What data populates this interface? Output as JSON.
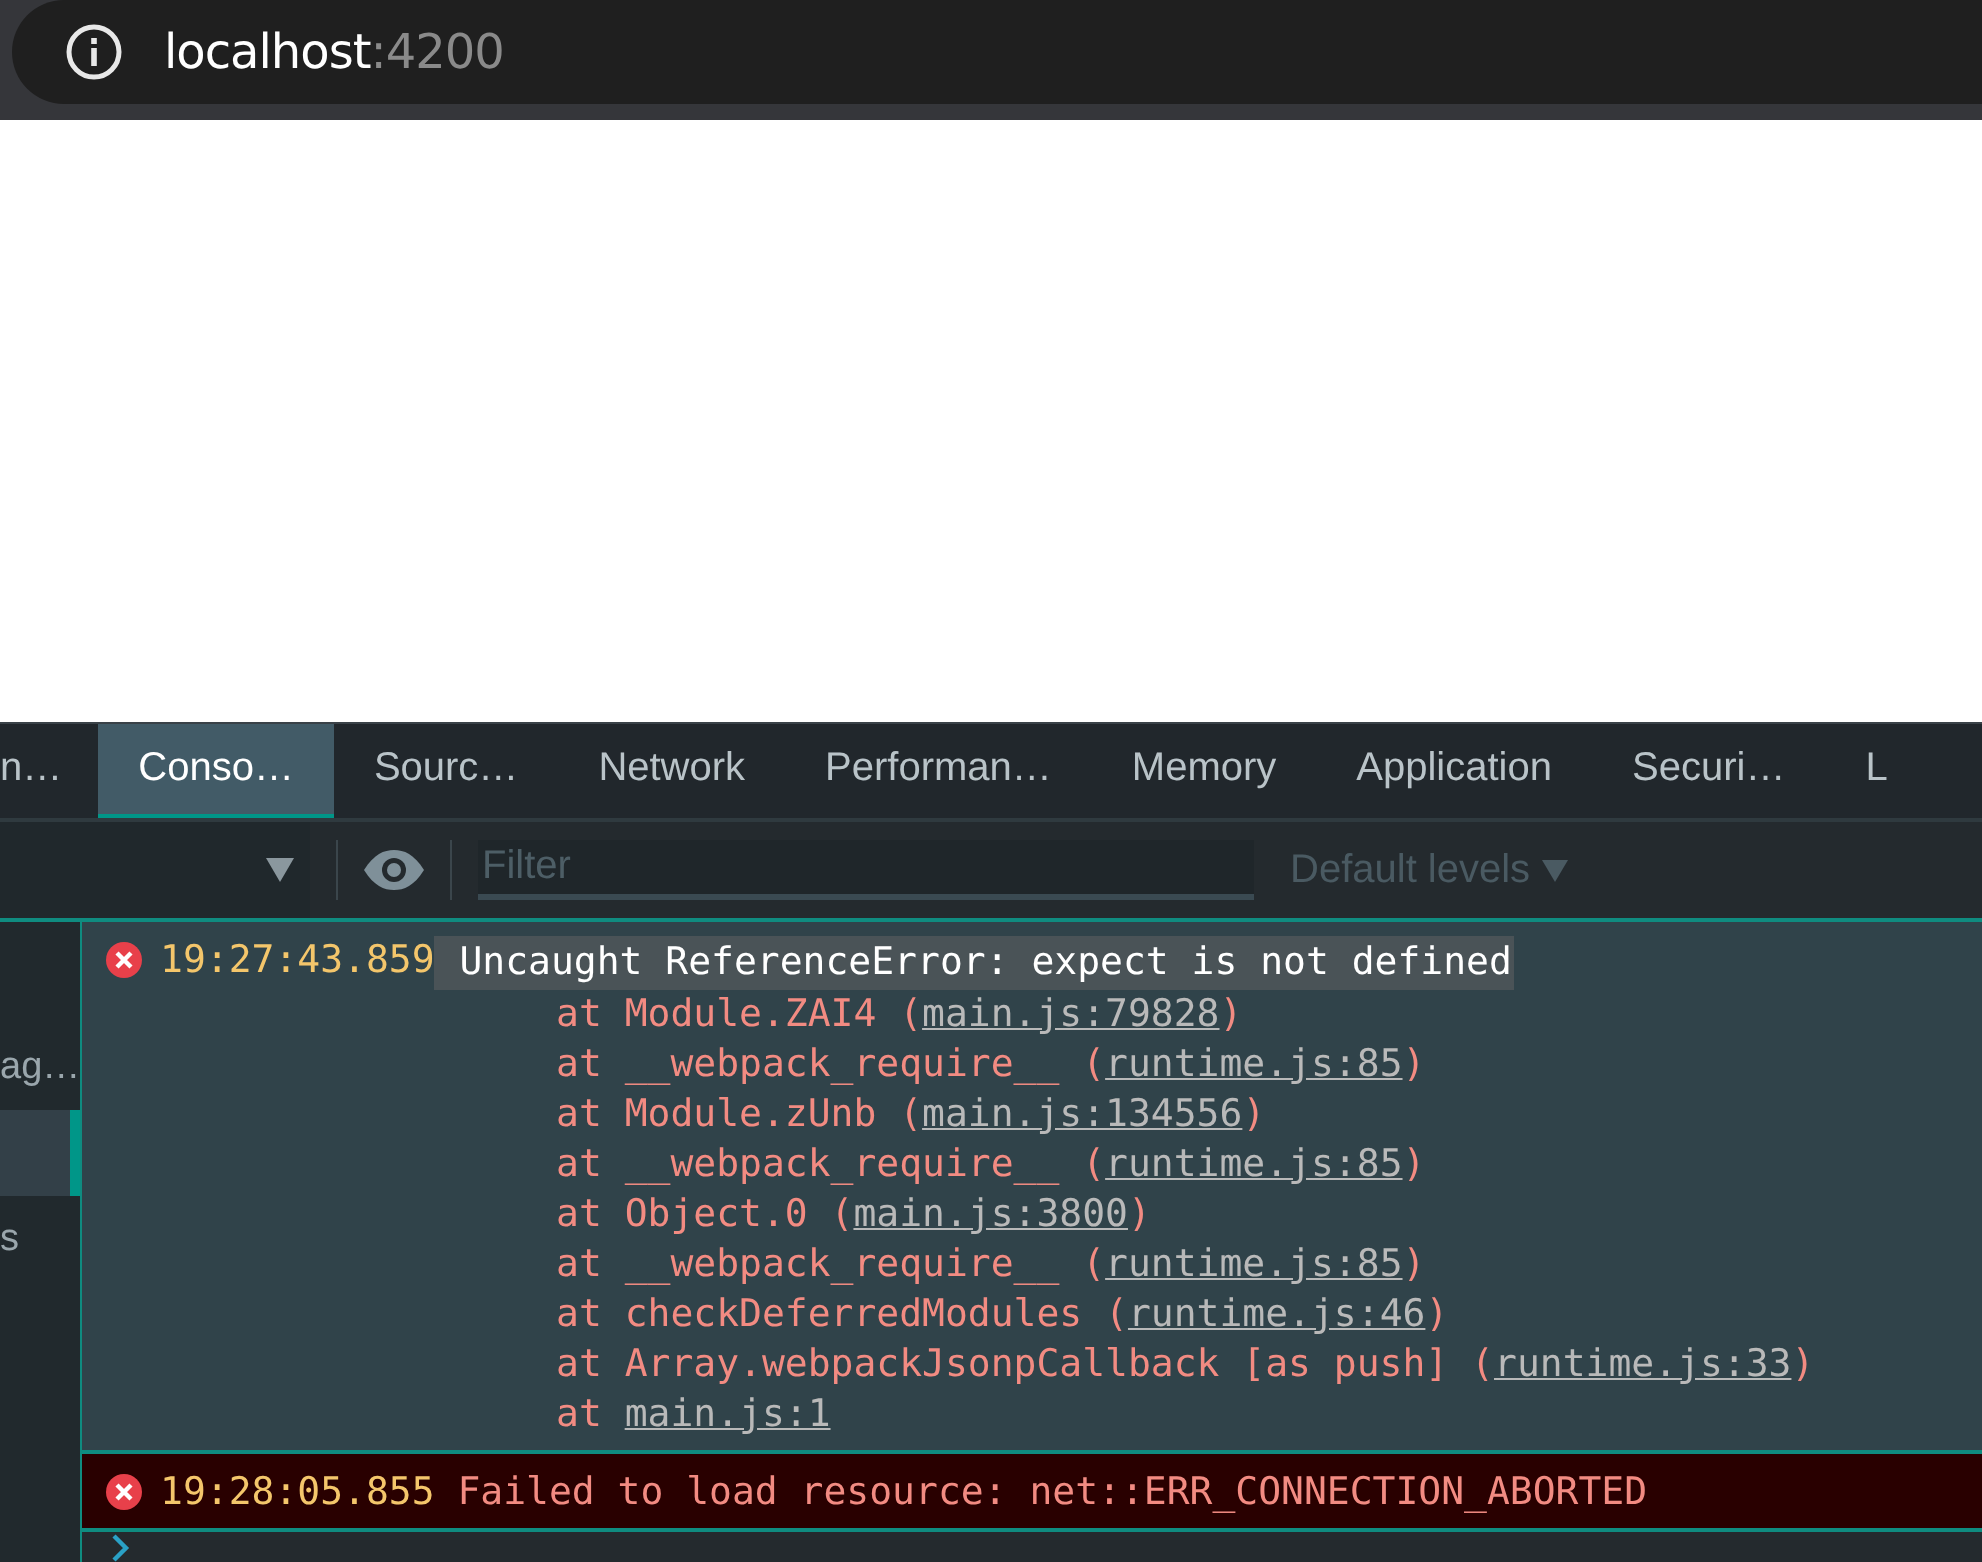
{
  "address_bar": {
    "host": "localhost",
    "port": ":4200"
  },
  "devtools": {
    "tabs": [
      {
        "label": "n…",
        "selected": false
      },
      {
        "label": "Conso…",
        "selected": true
      },
      {
        "label": "Sourc…",
        "selected": false
      },
      {
        "label": "Network",
        "selected": false
      },
      {
        "label": "Performan…",
        "selected": false
      },
      {
        "label": "Memory",
        "selected": false
      },
      {
        "label": "Application",
        "selected": false
      },
      {
        "label": "Securi…",
        "selected": false
      },
      {
        "label": "L",
        "selected": false
      }
    ],
    "toolbar": {
      "filter": {
        "placeholder": "Filter"
      },
      "levels": "Default levels"
    },
    "sidebar": [
      {
        "label": "ag…",
        "selected": false
      },
      {
        "selected": true
      },
      {
        "label": "s",
        "selected": false
      }
    ],
    "messages": [
      {
        "timestamp": "19:27:43.859",
        "text": "Uncaught ReferenceError: expect is not defined",
        "selected": true,
        "frames": [
          {
            "prefix": "at Module.ZAI4 (",
            "link": "main.js:79828",
            "suffix": ")"
          },
          {
            "prefix": "at __webpack_require__ (",
            "link": "runtime.js:85",
            "suffix": ")"
          },
          {
            "prefix": "at Module.zUnb (",
            "link": "main.js:134556",
            "suffix": ")"
          },
          {
            "prefix": "at __webpack_require__ (",
            "link": "runtime.js:85",
            "suffix": ")"
          },
          {
            "prefix": "at Object.0 (",
            "link": "main.js:3800",
            "suffix": ")"
          },
          {
            "prefix": "at __webpack_require__ (",
            "link": "runtime.js:85",
            "suffix": ")"
          },
          {
            "prefix": "at checkDeferredModules (",
            "link": "runtime.js:46",
            "suffix": ")"
          },
          {
            "prefix": "at Array.webpackJsonpCallback [as push] (",
            "link": "runtime.js:33",
            "suffix": ")"
          },
          {
            "prefix": "at ",
            "link": "main.js:1"
          }
        ]
      },
      {
        "timestamp": "19:28:05.855",
        "text": "Failed to load resource: net::ERR_CONNECTION_ABORTED",
        "selected": false
      }
    ]
  }
}
